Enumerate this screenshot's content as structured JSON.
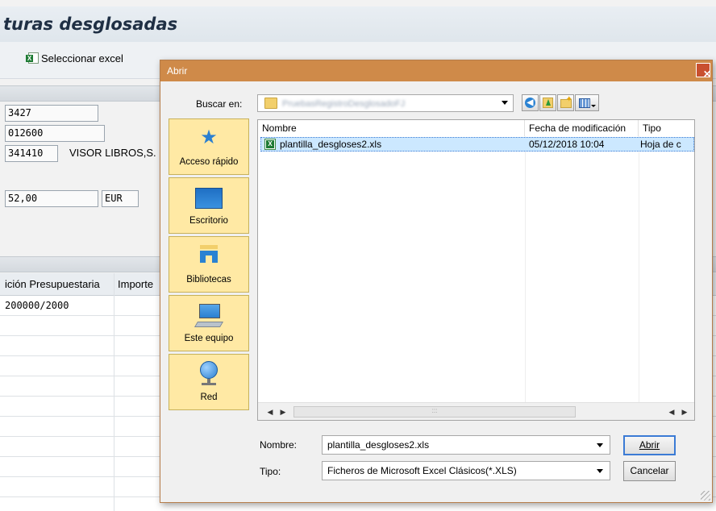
{
  "background": {
    "title": "turas desglosadas",
    "toolbar_button": "Seleccionar excel",
    "fields": {
      "f1": "3427",
      "f2": "012600",
      "f3": "341410",
      "vendor": "VISOR LIBROS,S.",
      "amount": "52,00",
      "currency": "EUR"
    },
    "grid": {
      "header_1": "ición Presupuestaria",
      "header_2": "Importe",
      "row1": "200000/2000"
    }
  },
  "dialog": {
    "title": "Abrir",
    "close_glyph": "✕",
    "look_in_label": "Buscar en:",
    "look_in_value": "PruebasRegistroDesglosadoFJ",
    "places": [
      {
        "label": "Acceso rápido"
      },
      {
        "label": "Escritorio"
      },
      {
        "label": "Bibliotecas"
      },
      {
        "label": "Este equipo"
      },
      {
        "label": "Red"
      }
    ],
    "columns": {
      "name": "Nombre",
      "date": "Fecha de modificación",
      "type": "Tipo"
    },
    "files": [
      {
        "name": "plantilla_desgloses2.xls",
        "date": "05/12/2018 10:04",
        "type": "Hoja de c"
      }
    ],
    "filename_label": "Nombre:",
    "filename_value": "plantilla_desgloses2.xls",
    "filetype_label": "Tipo:",
    "filetype_value": "Ficheros de Microsoft Excel Clásicos(*.XLS)",
    "open_button": "Abrir",
    "cancel_button": "Cancelar",
    "scroll_left": "◀",
    "scroll_right": "▶",
    "scroll_grip": ":::"
  },
  "colors": {
    "dialog_title_bar": "#cf8a49",
    "places_bg": "#ffe9a4",
    "selection": "#cce8ff",
    "excel_green": "#1e7b34"
  }
}
